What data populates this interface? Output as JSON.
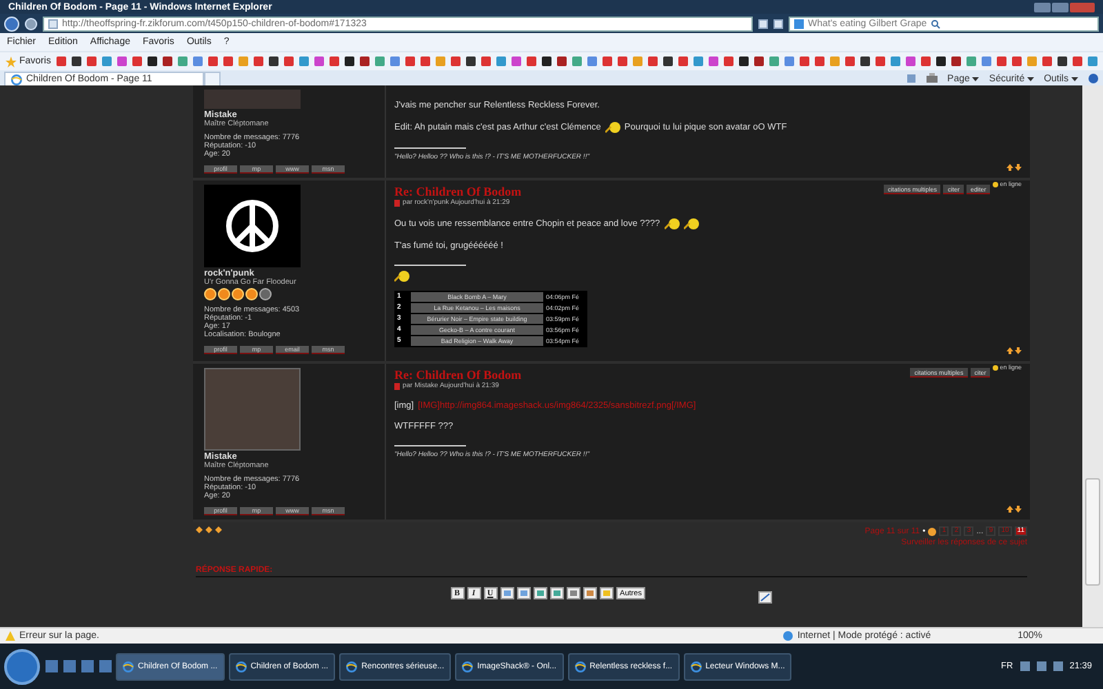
{
  "window": {
    "title": "Children Of Bodom - Page 11 - Windows Internet Explorer"
  },
  "address_bar": {
    "url": "http://theoffspring-fr.zikforum.com/t450p150-children-of-bodom#171323"
  },
  "search": {
    "value": "What's eating Gilbert Grape"
  },
  "menu": [
    "Fichier",
    "Edition",
    "Affichage",
    "Favoris",
    "Outils",
    "?"
  ],
  "favorites": {
    "label": "Favoris"
  },
  "tabs": [
    {
      "label": "Children Of Bodom - Page 11",
      "selected": true
    }
  ],
  "command_bar": [
    "Page",
    "Sécurité",
    "Outils"
  ],
  "posts": [
    {
      "avatar": {
        "kind": "cropped"
      },
      "author": "Mistake",
      "rank": "Maître Cléptomane",
      "stats": [
        "Nombre de messages: 7776",
        "Réputation: -10",
        "Age: 20"
      ],
      "buttons": [
        "profil",
        "mp",
        "www",
        "msn"
      ],
      "body": [
        [
          {
            "kind": "text",
            "text": "J'vais me pencher sur Relentless Reckless Forever."
          }
        ],
        [
          {
            "kind": "text",
            "text": "Edit: Ah putain mais c'est pas Arthur c'est Clémence"
          },
          {
            "kind": "smiley"
          },
          {
            "kind": "text",
            "text": "Pourquoi tu lui pique son avatar oO WTF"
          }
        ]
      ],
      "signature": [
        {
          "kind": "quote",
          "text": "\"Hello? Helloo ?? Who is this !? - IT'S ME MOTHERFUCKER !!\""
        }
      ]
    },
    {
      "avatar": {
        "kind": "peace"
      },
      "author": "rock'n'punk",
      "rank": "U'r Gonna Go Far Floodeur",
      "stars": 4,
      "stats": [
        "Nombre de messages: 4503",
        "Réputation: -1",
        "Age: 17",
        "Localisation: Boulogne"
      ],
      "buttons": [
        "profil",
        "mp",
        "email",
        "msn"
      ],
      "title": "Re: Children Of Bodom",
      "byline": "par rock'n'punk Aujourd'hui à 21:29",
      "actions": [
        "citations multiples",
        "citer",
        "editer"
      ],
      "status": "en ligne",
      "body": [
        [
          {
            "kind": "text",
            "text": "Ou tu vois une ressemblance entre Chopin et peace and love ????"
          },
          {
            "kind": "smiley"
          },
          {
            "kind": "smiley"
          }
        ],
        [
          {
            "kind": "text",
            "text": "T'as fumé toi, grugéééééé !"
          }
        ]
      ],
      "signature": [
        {
          "kind": "smiley"
        },
        {
          "kind": "tracks",
          "rows": [
            {
              "rank": "1",
              "track": "Black Bomb A – Mary",
              "time": "04:06pm Fé"
            },
            {
              "rank": "2",
              "track": "La Rue Ketanou – Les maisons",
              "time": "04:02pm Fé"
            },
            {
              "rank": "3",
              "track": "Bérurier Noir – Empire state building",
              "time": "03:59pm Fé"
            },
            {
              "rank": "4",
              "track": "Gecko-B – A contre courant",
              "time": "03:56pm Fé"
            },
            {
              "rank": "5",
              "track": "Bad Religion – Walk Away",
              "time": "03:54pm Fé"
            }
          ]
        }
      ]
    },
    {
      "avatar": {
        "kind": "photo"
      },
      "author": "Mistake",
      "rank": "Maître Cléptomane",
      "stats": [
        "Nombre de messages: 7776",
        "Réputation: -10",
        "Age: 20"
      ],
      "buttons": [
        "profil",
        "mp",
        "www",
        "msn"
      ],
      "title": "Re: Children Of Bodom",
      "byline": "par Mistake Aujourd'hui à 21:39",
      "actions": [
        "citations multiples",
        "citer"
      ],
      "status": "en ligne",
      "body": [
        [
          {
            "kind": "tag",
            "text": "[img]"
          },
          {
            "kind": "link",
            "text": "[IMG]http://img864.imageshack.us/img864/2325/sansbitrezf.png[/IMG]"
          }
        ],
        [
          {
            "kind": "text",
            "text": "WTFFFFF ???"
          }
        ]
      ],
      "signature": [
        {
          "kind": "quote",
          "text": "\"Hello? Helloo ?? Who is this !? - IT'S ME MOTHERFUCKER !!\""
        }
      ]
    }
  ],
  "pagination": {
    "label": "Page 11 sur 11",
    "separator": "•",
    "pages": [
      {
        "kind": "page",
        "label": "1",
        "selected": false
      },
      {
        "kind": "page",
        "label": "2",
        "selected": false
      },
      {
        "kind": "page",
        "label": "3",
        "selected": false
      },
      {
        "kind": "gap",
        "label": "..."
      },
      {
        "kind": "page",
        "label": "9",
        "selected": false
      },
      {
        "kind": "page",
        "label": "10",
        "selected": false
      },
      {
        "kind": "page",
        "label": "11",
        "selected": true
      }
    ]
  },
  "watch_link": "Surveiller les réponses de ce sujet",
  "quick_reply": {
    "title": "RÉPONSE RAPIDE:",
    "format_buttons": [
      "B",
      "I",
      "U"
    ],
    "more": "Autres"
  },
  "status_bar": {
    "message": "Erreur sur la page.",
    "zone": "Internet | Mode protégé : activé",
    "zoom": "100%"
  },
  "taskbar": {
    "tasks": [
      {
        "label": "Children Of Bodom ...",
        "selected": true
      },
      {
        "label": "Children of Bodom ...",
        "selected": false
      },
      {
        "label": "Rencontres sérieuse...",
        "selected": false
      },
      {
        "label": "ImageShack® - Onl...",
        "selected": false
      },
      {
        "label": "Relentless reckless f...",
        "selected": false
      },
      {
        "label": "Lecteur Windows M...",
        "selected": false
      }
    ],
    "language": "FR",
    "clock": "21:39"
  }
}
